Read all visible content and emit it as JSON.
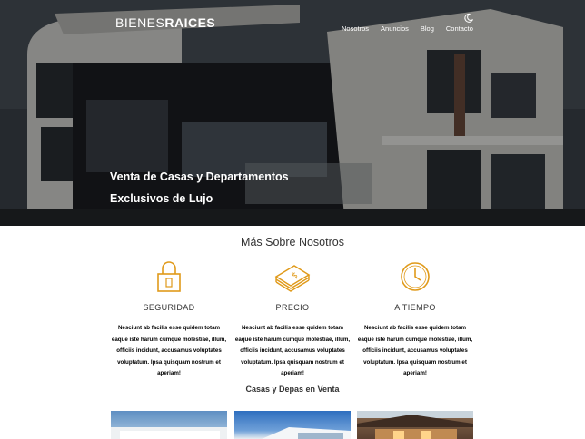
{
  "brand": {
    "light": "BIENES",
    "bold": "RAICES"
  },
  "nav": {
    "items": [
      "Nosotros",
      "Anuncios",
      "Blog",
      "Contacto"
    ],
    "theme_toggle_icon": "moon-icon"
  },
  "hero": {
    "title_line1": "Venta de Casas y Departamentos",
    "title_line2": "Exclusivos de Lujo"
  },
  "about": {
    "title": "Más Sobre Nosotros",
    "features": [
      {
        "icon": "padlock-icon",
        "label": "SEGURIDAD",
        "desc": "Nesciunt ab facilis esse quidem totam eaque iste harum cumque molestiae, illum, officiis incidunt, accusamus voluptates voluptatum. Ipsa quisquam nostrum et aperiam!"
      },
      {
        "icon": "money-stack-icon",
        "label": "PRECIO",
        "desc": "Nesciunt ab facilis esse quidem totam eaque iste harum cumque molestiae, illum, officiis incidunt, accusamus voluptates voluptatum. Ipsa quisquam nostrum et aperiam!"
      },
      {
        "icon": "clock-icon",
        "label": "A TIEMPO",
        "desc": "Nesciunt ab facilis esse quidem totam eaque iste harum cumque molestiae, illum, officiis incidunt, accusamus voluptates voluptatum. Ipsa quisquam nostrum et aperiam!"
      }
    ]
  },
  "listings": {
    "title": "Casas y Depas en Venta"
  },
  "colors": {
    "accent": "#e09a1a",
    "hero_text": "#ffffff",
    "body_text": "#333333"
  }
}
